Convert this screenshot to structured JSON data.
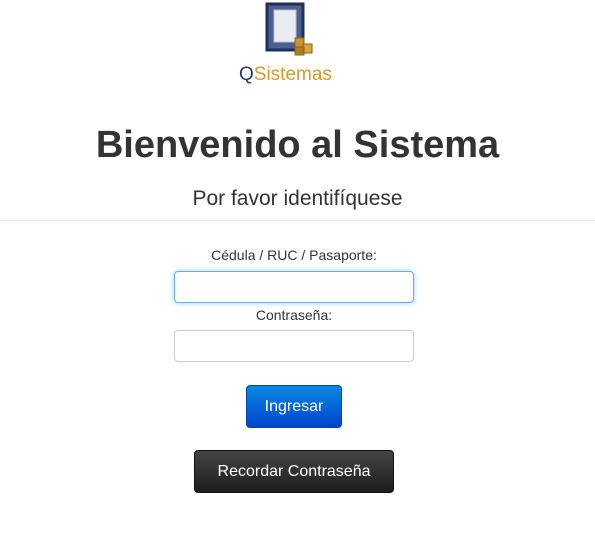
{
  "logo": {
    "icon": "qsistemas-logo-icon",
    "text_q": "Q",
    "text_rest": "Sistemas"
  },
  "header": {
    "title": "Bienvenido al Sistema",
    "subtitle": "Por favor identifíquese"
  },
  "form": {
    "id_label": "Cédula / RUC / Pasaporte:",
    "id_value": "",
    "password_label": "Contraseña:",
    "password_value": "",
    "submit_label": "Ingresar",
    "recover_label": "Recordar Contraseña"
  },
  "colors": {
    "primary": "#0055cc",
    "dark_button": "#2b2b2b",
    "logo_blue": "#243a6e",
    "logo_gold": "#d49a2a"
  }
}
